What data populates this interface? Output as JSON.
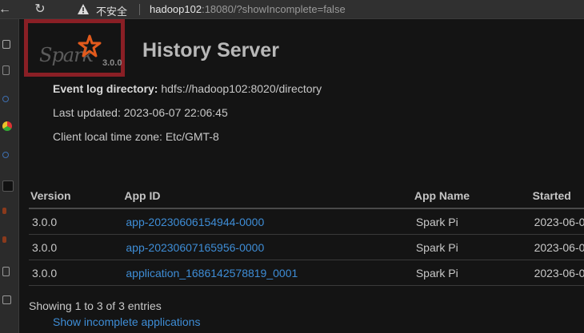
{
  "browser": {
    "insecure_label": "不安全",
    "url_host": "hadoop102",
    "url_rest": ":18080/?showIncomplete=false"
  },
  "logo": {
    "word": "Spark",
    "version": "3.0.0"
  },
  "page": {
    "title": "History Server",
    "event_log_label": "Event log directory:",
    "event_log_value": "hdfs://hadoop102:8020/directory",
    "last_updated": "Last updated: 2023-06-07 22:06:45",
    "timezone": "Client local time zone: Etc/GMT-8"
  },
  "table": {
    "headers": [
      "Version",
      "App ID",
      "App Name",
      "Started"
    ],
    "rows": [
      {
        "version": "3.0.0",
        "app_id": "app-20230606154944-0000",
        "app_name": "Spark Pi",
        "started": "2023-06-0"
      },
      {
        "version": "3.0.0",
        "app_id": "app-20230607165956-0000",
        "app_name": "Spark Pi",
        "started": "2023-06-0"
      },
      {
        "version": "3.0.0",
        "app_id": "application_1686142578819_0001",
        "app_name": "Spark Pi",
        "started": "2023-06-0"
      }
    ]
  },
  "footer": {
    "showing": "Showing 1 to 3 of 3 entries",
    "incomplete_link": "Show incomplete applications"
  },
  "colors": {
    "link": "#3e8dd6",
    "highlight_box": "#8a1f25",
    "spark_orange": "#e25a1c"
  },
  "icons": [
    "back-icon",
    "reload-icon",
    "warning-icon",
    "spark-star-icon"
  ]
}
